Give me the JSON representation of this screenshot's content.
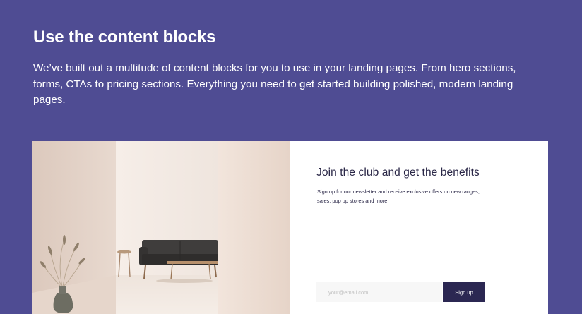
{
  "section": {
    "title": "Use the content blocks",
    "description": "We’ve built out a multitude of content blocks for you to use in your landing pages. From hero sections, forms, CTAs to pricing sections. Everything you need to get started building polished, modern landing pages."
  },
  "newsletter": {
    "heading": "Join the club and get the benefits",
    "description": "Sign up for our newsletter and receive exclusive offers on new ranges, sales, pop up stores and more",
    "email_placeholder": "your@email.com",
    "submit_label": "Sign up"
  },
  "colors": {
    "background": "#4f4c93",
    "button": "#2b2752",
    "card": "#ffffff"
  }
}
